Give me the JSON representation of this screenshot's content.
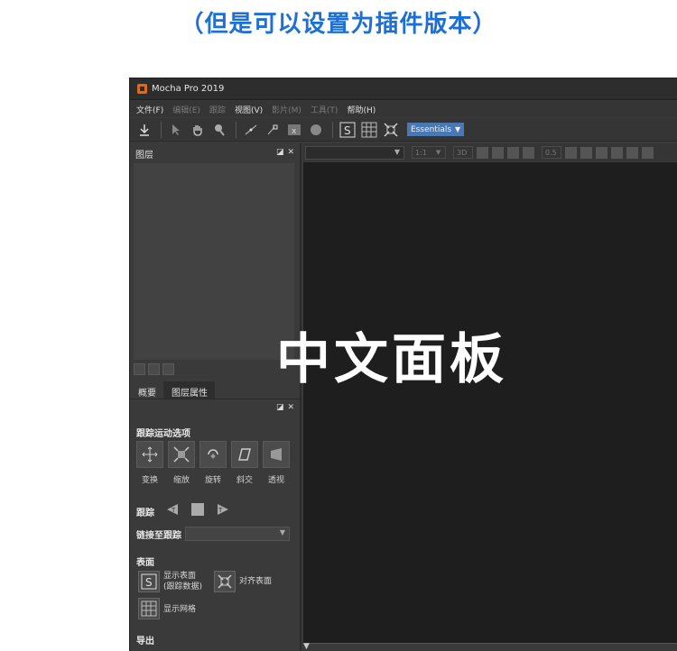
{
  "caption": "（但是可以设置为插件版本）",
  "window": {
    "title": "Mocha Pro 2019"
  },
  "menu": {
    "items": [
      {
        "label": "文件(F)",
        "enabled": true
      },
      {
        "label": "编辑(E)",
        "enabled": false
      },
      {
        "label": "跟踪",
        "enabled": false
      },
      {
        "label": "视图(V)",
        "enabled": true
      },
      {
        "label": "影片(M)",
        "enabled": false
      },
      {
        "label": "工具(T)",
        "enabled": false
      },
      {
        "label": "帮助(H)",
        "enabled": true
      }
    ]
  },
  "toolbar": {
    "workspace": "Essentials"
  },
  "layers_panel": {
    "title": "图层"
  },
  "tabs": [
    "概要",
    "图层属性"
  ],
  "track_motion": {
    "title": "跟踪运动选项",
    "options": [
      "变换",
      "缩放",
      "旋转",
      "斜交",
      "透视"
    ]
  },
  "track": {
    "label": "跟踪"
  },
  "link": {
    "label": "链接至跟踪",
    "value": ""
  },
  "surface": {
    "title": "表面",
    "show_surface_line1": "显示表面",
    "show_surface_line2": "(跟踪数据)",
    "align_surface": "对齐表面",
    "show_grid": "显示网格"
  },
  "export": {
    "title": "导出"
  },
  "viewer": {
    "zoom": "1:1",
    "proxy": "3D",
    "opacity": "0.5"
  },
  "overlay": {
    "text": "中文面板"
  },
  "colors": {
    "caption": "#1c6fd6",
    "essentials_bg": "#4a78b3",
    "viewer_bg": "#1e1e1e",
    "panel_bg": "#3a3a3a"
  }
}
